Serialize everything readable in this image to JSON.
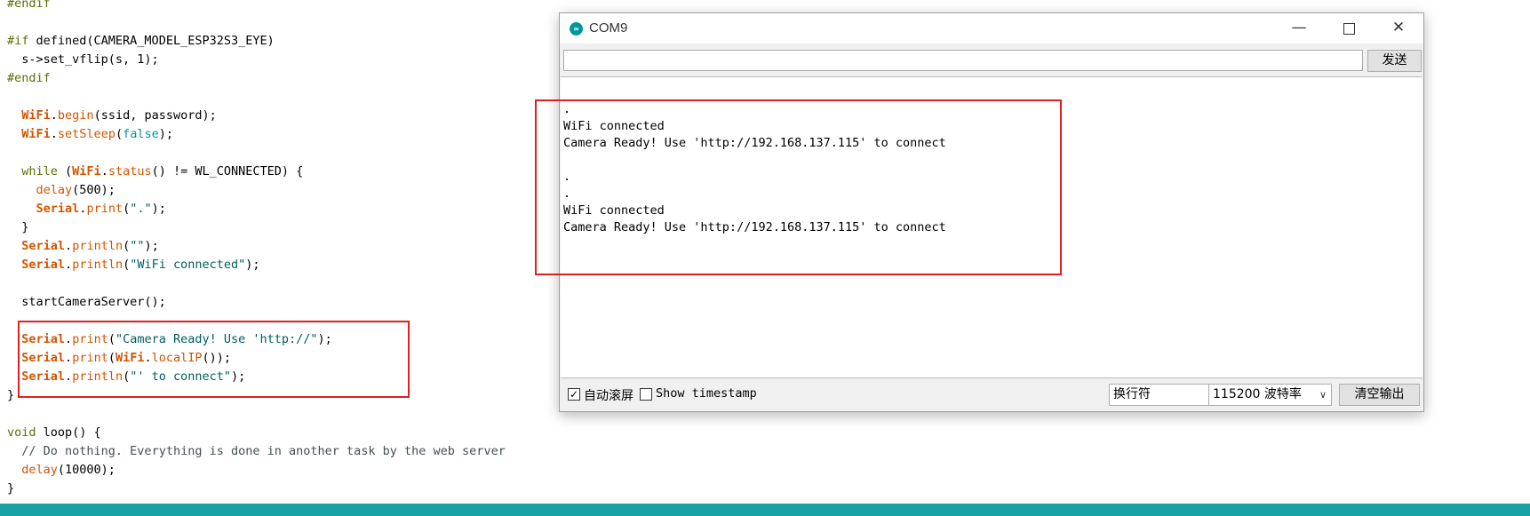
{
  "editor": {
    "lines": [
      "#endif",
      "",
      "#if defined(CAMERA_MODEL_ESP32S3_EYE)",
      "  s->set_vflip(s, 1);",
      "#endif",
      "",
      "  WiFi.begin(ssid, password);",
      "  WiFi.setSleep(false);",
      "",
      "  while (WiFi.status() != WL_CONNECTED) {",
      "    delay(500);",
      "    Serial.print(\".\");",
      "  }",
      "  Serial.println(\"\");",
      "  Serial.println(\"WiFi connected\");",
      "",
      "  startCameraServer();",
      "",
      "  Serial.print(\"Camera Ready! Use 'http://\");",
      "  Serial.print(WiFi.localIP());",
      "  Serial.println(\"' to connect\");",
      "}",
      "",
      "void loop() {",
      "  // Do nothing. Everything is done in another task by the web server",
      "  delay(10000);",
      "}"
    ]
  },
  "monitor": {
    "title": "COM9",
    "send_input_value": "",
    "send_label": "发送",
    "output_lines": [
      ".",
      "WiFi connected",
      "Camera Ready! Use 'http://192.168.137.115' to connect",
      "",
      ".",
      ".",
      "WiFi connected",
      "Camera Ready! Use 'http://192.168.137.115' to connect"
    ],
    "autoscroll_label": "自动滚屏",
    "autoscroll_checked": true,
    "timestamp_label": "Show timestamp",
    "timestamp_checked": false,
    "line_ending": "换行符",
    "baud_rate": "115200 波特率",
    "clear_label": "清空输出",
    "icons": {
      "app": "arduino-icon",
      "minimize": "minimize-icon",
      "maximize": "maximize-icon",
      "close": "close-icon"
    }
  },
  "colors": {
    "highlight": "#e02020",
    "status_bar": "#17a1a5",
    "keyword": "#5e6d03",
    "function": "#d35400",
    "string": "#005c5f"
  }
}
